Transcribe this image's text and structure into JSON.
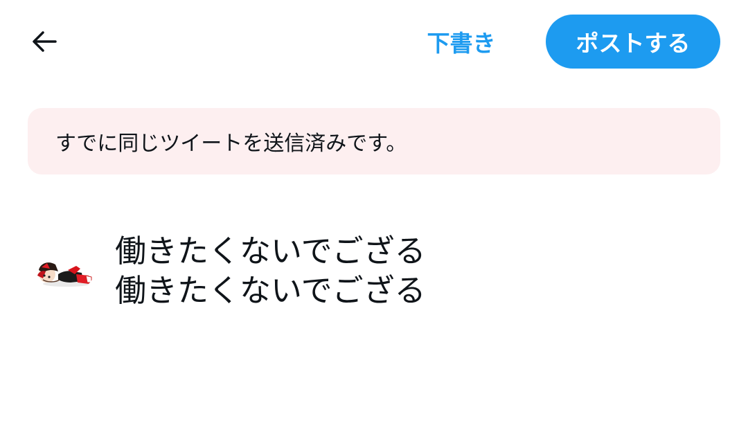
{
  "header": {
    "back_icon": "arrow-left-icon",
    "drafts_label": "下書き",
    "post_label": "ポストする"
  },
  "banner": {
    "message": "すでに同じツイートを送信済みです。"
  },
  "composer": {
    "avatar": "chibi-character-avatar",
    "lines": [
      "働きたくないでござる",
      "働きたくないでござる"
    ]
  },
  "colors": {
    "accent": "#1d9bf0",
    "error_background": "#fdeff0",
    "text": "#0f1419"
  }
}
